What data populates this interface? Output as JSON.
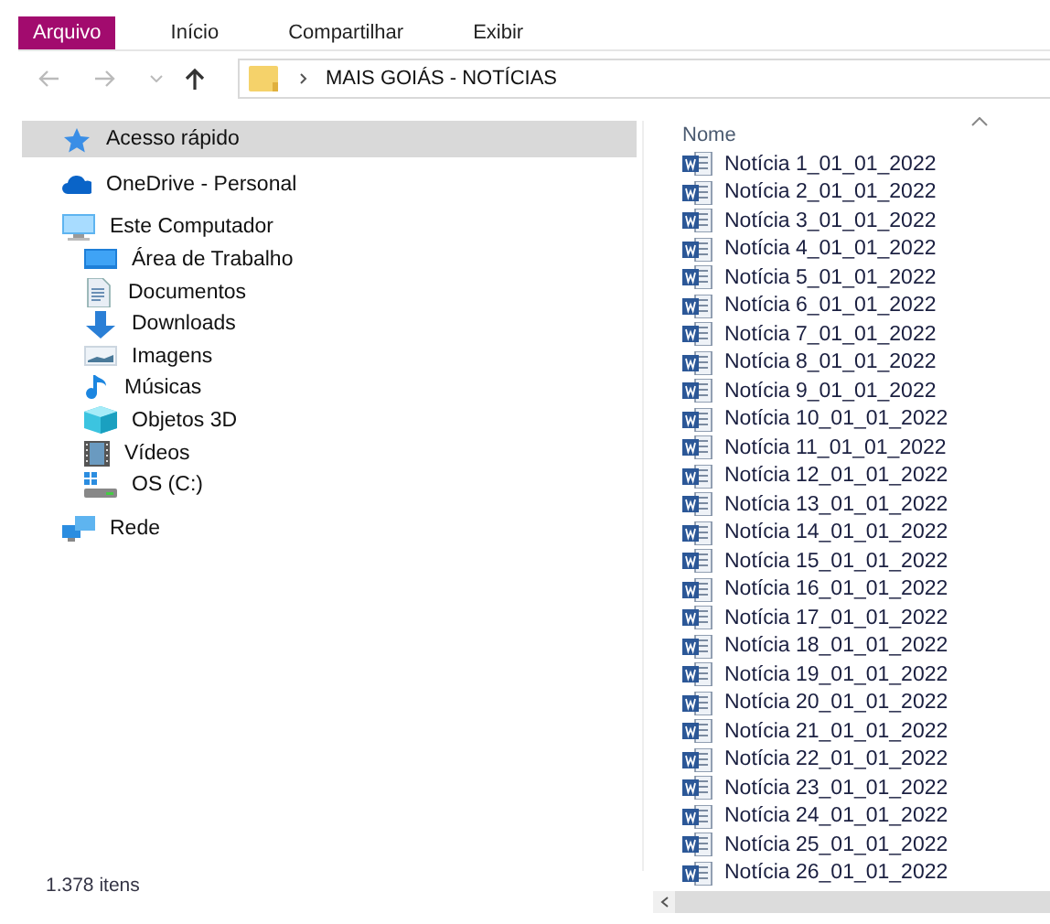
{
  "ribbon_tabs": [
    {
      "label": "Arquivo",
      "selected": true
    },
    {
      "label": "Início",
      "selected": false
    },
    {
      "label": "Compartilhar",
      "selected": false
    },
    {
      "label": "Exibir",
      "selected": false
    }
  ],
  "address_bar": {
    "path": "MAIS GOIÁS - NOTÍCIAS"
  },
  "sidebar": {
    "items": [
      {
        "kind": "quick",
        "label": "Acesso rápido",
        "selected": true
      },
      {
        "kind": "onedrive",
        "label": "OneDrive - Personal",
        "selected": false
      },
      {
        "kind": "computer",
        "label": "Este Computador",
        "selected": false,
        "children": [
          {
            "kind": "desktop",
            "label": "Área de Trabalho",
            "selected": false
          },
          {
            "kind": "documents",
            "label": "Documentos",
            "selected": false
          },
          {
            "kind": "downloads",
            "label": "Downloads",
            "selected": false
          },
          {
            "kind": "pictures",
            "label": "Imagens",
            "selected": false
          },
          {
            "kind": "music",
            "label": "Músicas",
            "selected": false
          },
          {
            "kind": "objects",
            "label": "Objetos 3D",
            "selected": false
          },
          {
            "kind": "videos",
            "label": "Vídeos",
            "selected": false
          },
          {
            "kind": "drive",
            "label": "OS (C:)",
            "selected": false
          }
        ]
      },
      {
        "kind": "network",
        "label": "Rede",
        "selected": false
      }
    ]
  },
  "file_list": {
    "column": "Nome",
    "files": [
      "Notícia 1_01_01_2022",
      "Notícia 2_01_01_2022",
      "Notícia 3_01_01_2022",
      "Notícia 4_01_01_2022",
      "Notícia 5_01_01_2022",
      "Notícia 6_01_01_2022",
      "Notícia 7_01_01_2022",
      "Notícia 8_01_01_2022",
      "Notícia 9_01_01_2022",
      "Notícia 10_01_01_2022",
      "Notícia 11_01_01_2022",
      "Notícia 12_01_01_2022",
      "Notícia 13_01_01_2022",
      "Notícia 14_01_01_2022",
      "Notícia 15_01_01_2022",
      "Notícia 16_01_01_2022",
      "Notícia 17_01_01_2022",
      "Notícia 18_01_01_2022",
      "Notícia 19_01_01_2022",
      "Notícia 20_01_01_2022",
      "Notícia 21_01_01_2022",
      "Notícia 22_01_01_2022",
      "Notícia 23_01_01_2022",
      "Notícia 24_01_01_2022",
      "Notícia 25_01_01_2022",
      "Notícia 26_01_01_2022"
    ]
  },
  "status_bar": {
    "count": "1.378 itens"
  }
}
